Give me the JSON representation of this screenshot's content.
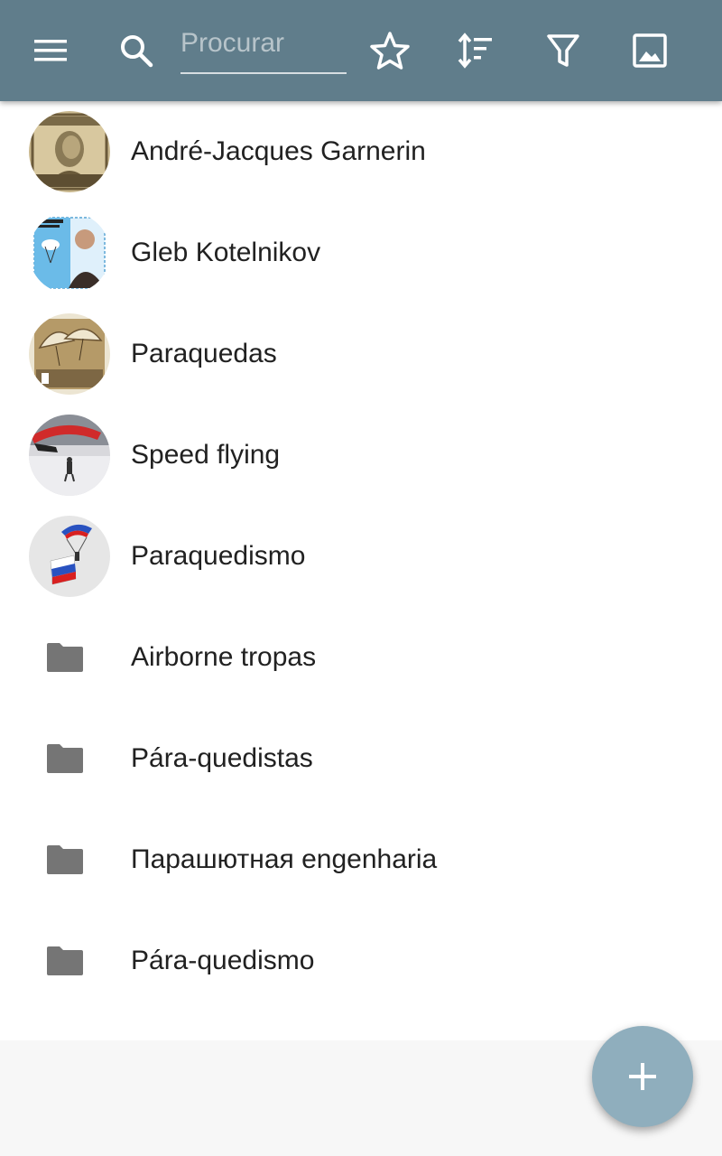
{
  "colors": {
    "toolbar": "#607d8b",
    "fab": "#8faebd",
    "folder_icon": "#757575",
    "text": "#212121"
  },
  "toolbar": {
    "menu_icon": "menu-icon",
    "search_icon": "search-icon",
    "search_placeholder": "Procurar",
    "search_value": "",
    "favorite_icon": "star-outline-icon",
    "sort_icon": "sort-icon",
    "filter_icon": "filter-icon",
    "image_icon": "image-icon"
  },
  "items": [
    {
      "label": "André-Jacques Garnerin",
      "kind": "image",
      "icon": "portrait-thumbnail"
    },
    {
      "label": "Gleb Kotelnikov",
      "kind": "image",
      "icon": "stamp-thumbnail"
    },
    {
      "label": "Paraquedas",
      "kind": "image",
      "icon": "parachute-stamp-thumbnail"
    },
    {
      "label": "Speed flying",
      "kind": "image",
      "icon": "speed-flying-thumbnail"
    },
    {
      "label": "Paraquedismo",
      "kind": "image",
      "icon": "skydiver-thumbnail"
    },
    {
      "label": "Airborne tropas",
      "kind": "folder",
      "icon": "folder-icon"
    },
    {
      "label": "Pára-quedistas",
      "kind": "folder",
      "icon": "folder-icon"
    },
    {
      "label": "Парашютная engenharia",
      "kind": "folder",
      "icon": "folder-icon"
    },
    {
      "label": "Pára-quedismo",
      "kind": "folder",
      "icon": "folder-icon"
    }
  ],
  "fab": {
    "icon": "plus-icon"
  }
}
